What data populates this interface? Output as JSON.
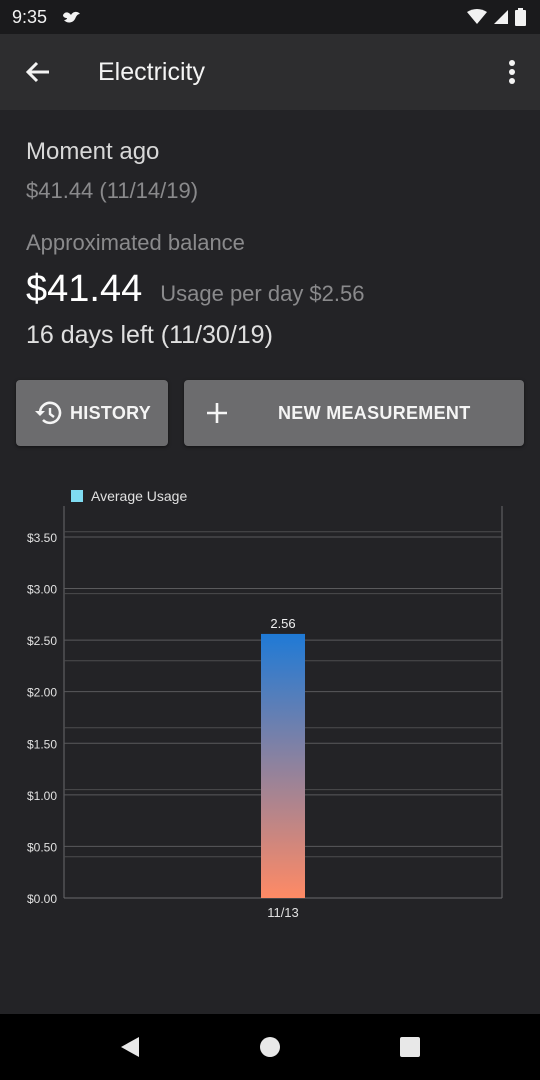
{
  "status_bar": {
    "time": "9:35"
  },
  "app_bar": {
    "title": "Electricity"
  },
  "summary": {
    "last_update": "Moment ago",
    "last_amount": "$41.44 (11/14/19)",
    "approx_label": "Approximated balance",
    "balance": "$41.44",
    "usage_per_day": "Usage per day $2.56",
    "days_left": "16 days left (11/30/19)"
  },
  "buttons": {
    "history": "HISTORY",
    "new_measurement": "NEW MEASUREMENT"
  },
  "chart_data": {
    "type": "bar",
    "categories": [
      "11/13"
    ],
    "series": [
      {
        "name": "Average Usage",
        "values": [
          2.56
        ]
      }
    ],
    "data_labels": [
      "2.56"
    ],
    "y_ticks": [
      0,
      0.5,
      1.0,
      1.5,
      2.0,
      2.5,
      3.0,
      3.5
    ],
    "y_tick_labels": [
      "$0.00",
      "$0.50",
      "$1.00",
      "$1.50",
      "$2.00",
      "$2.50",
      "$3.00",
      "$3.50"
    ],
    "ylim": [
      0,
      3.5
    ],
    "grid": true,
    "legend": "top-left",
    "bar_gradient": [
      "#1f7ad6",
      "#ff8a65"
    ],
    "legend_color": "#7fdcf2"
  },
  "icons": {
    "back": "arrow-left-icon",
    "overflow": "more-vert-icon",
    "history": "history-icon",
    "add": "plus-icon"
  }
}
